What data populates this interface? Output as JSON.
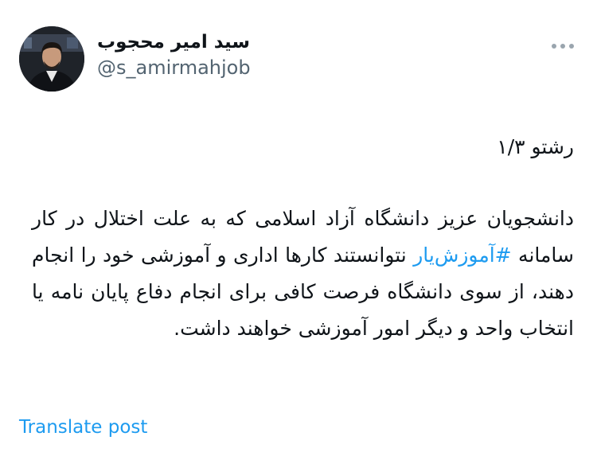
{
  "author": {
    "display_name": "سید امیر محجوب",
    "handle": "@s_amirmahjob"
  },
  "icons": {
    "more": "more-horizontal-icon",
    "avatar": "profile-photo"
  },
  "tweet": {
    "thread_label": "رشتو ۱/۳",
    "body_part1": "دانشجویان عزیز دانشگاه آزاد اسلامی که به علت اختلال در کار سامانه ",
    "hashtag": "#آموزش‌یار",
    "body_part2": " نتوانستند کارها اداری و آموزشی خود را انجام دهند، از سوی دانشگاه فرصت کافی برای انجام دفاع پایان نامه یا انتخاب واحد و دیگر امور آموزشی خواهند داشت."
  },
  "actions": {
    "translate_label": "Translate post"
  },
  "colors": {
    "link": "#1d9bf0",
    "secondary_text": "#536471",
    "primary_text": "#0f1419"
  }
}
